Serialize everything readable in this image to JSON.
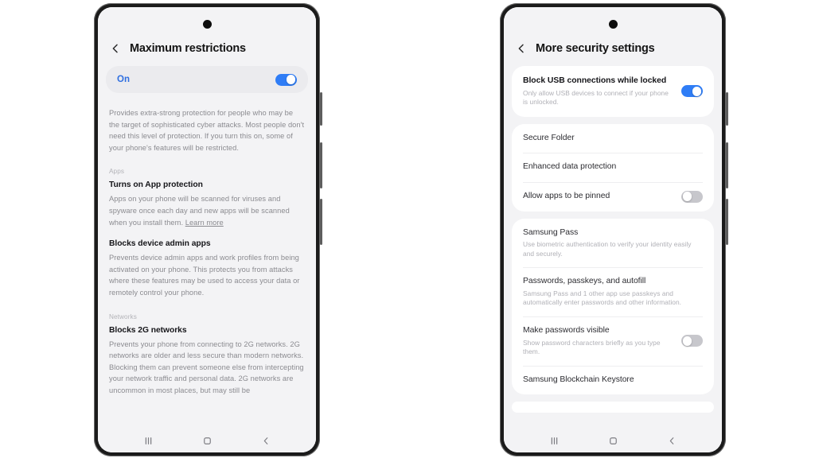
{
  "page": {
    "background_color": "#ffffff",
    "accent_color": "#2f7df6",
    "card_color": "#ffffff",
    "screen_bg_color": "#f3f3f5"
  },
  "phone_left": {
    "header": {
      "back_icon": "chevron-left-icon",
      "title": "Maximum restrictions"
    },
    "toggle_row": {
      "label": "On",
      "state": "on"
    },
    "intro": "Provides extra-strong protection for people who may be the target of sophisticated cyber attacks. Most people don't need this level of protection. If you turn this on, some of your phone's features will be restricted.",
    "sections": [
      {
        "label": "Apps",
        "items": [
          {
            "title": "Turns on App protection",
            "body": "Apps on your phone will be scanned for viruses and spyware once each day and new apps will be scanned when you install them. ",
            "link": "Learn more"
          },
          {
            "title": "Blocks device admin apps",
            "body": "Prevents device admin apps and work profiles from being activated on your phone. This protects you from attacks where these features may be used to access your data or remotely control your phone.",
            "link": ""
          }
        ]
      },
      {
        "label": "Networks",
        "items": [
          {
            "title": "Blocks 2G networks",
            "body": "Prevents your phone from connecting to 2G networks. 2G networks are older and less secure than modern networks. Blocking them can prevent someone else from intercepting your network traffic and personal data. 2G networks are uncommon in most places, but may still be",
            "link": ""
          }
        ]
      }
    ],
    "navbar": {
      "recents": "recents-icon",
      "home": "home-icon",
      "back": "back-icon"
    }
  },
  "phone_right": {
    "header": {
      "back_icon": "chevron-left-icon",
      "title": "More security settings"
    },
    "cards": [
      {
        "rows": [
          {
            "title": "Block USB connections while locked",
            "title_bold": true,
            "sub": "Only allow USB devices to connect if your phone is unlocked.",
            "toggle": "on"
          }
        ]
      },
      {
        "rows": [
          {
            "title": "Secure Folder",
            "title_bold": false,
            "sub": "",
            "toggle": "none"
          },
          {
            "title": "Enhanced data protection",
            "title_bold": false,
            "sub": "",
            "toggle": "none"
          },
          {
            "title": "Allow apps to be pinned",
            "title_bold": false,
            "sub": "",
            "toggle": "off"
          }
        ]
      },
      {
        "rows": [
          {
            "title": "Samsung Pass",
            "title_bold": false,
            "sub": "Use biometric authentication to verify your identity easily and securely.",
            "toggle": "none"
          },
          {
            "title": "Passwords, passkeys, and autofill",
            "title_bold": false,
            "sub": "Samsung Pass and 1 other app use passkeys and automatically enter passwords and other information.",
            "toggle": "none"
          },
          {
            "title": "Make passwords visible",
            "title_bold": false,
            "sub": "Show password characters briefly as you type them.",
            "toggle": "off"
          },
          {
            "title": "Samsung Blockchain Keystore",
            "title_bold": false,
            "sub": "",
            "toggle": "none"
          }
        ]
      }
    ],
    "navbar": {
      "recents": "recents-icon",
      "home": "home-icon",
      "back": "back-icon"
    }
  }
}
